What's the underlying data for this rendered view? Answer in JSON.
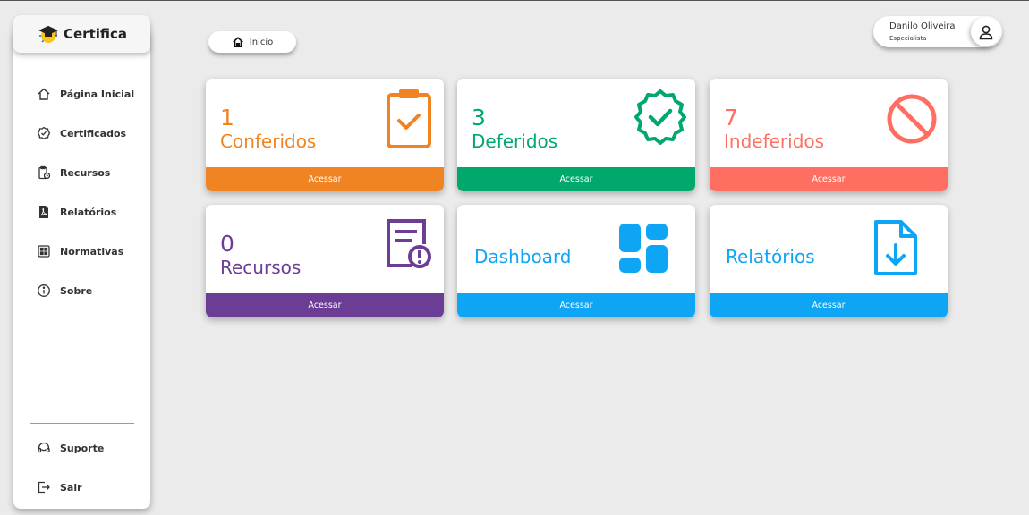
{
  "app": {
    "logo_text": "Certifica"
  },
  "sidebar": {
    "items": [
      {
        "label": "Página Inicial",
        "icon": "home-icon"
      },
      {
        "label": "Certificados",
        "icon": "badge-check-icon"
      },
      {
        "label": "Recursos",
        "icon": "clipboard-clock-icon"
      },
      {
        "label": "Relatórios",
        "icon": "pdf-file-icon"
      },
      {
        "label": "Normativas",
        "icon": "grid-icon"
      },
      {
        "label": "Sobre",
        "icon": "info-icon"
      }
    ],
    "bottom": [
      {
        "label": "Suporte",
        "icon": "headset-icon"
      },
      {
        "label": "Sair",
        "icon": "logout-icon"
      }
    ]
  },
  "breadcrumb": {
    "label": "Início"
  },
  "user": {
    "name": "Danilo Oliveira",
    "role": "Especialista"
  },
  "cards": [
    {
      "value": "1",
      "label": "Conferidos",
      "button": "Acessar",
      "color": "#f08423",
      "icon": "clipboard-check-icon"
    },
    {
      "value": "3",
      "label": "Deferidos",
      "button": "Acessar",
      "color": "#00a86b",
      "icon": "badge-check-icon"
    },
    {
      "value": "7",
      "label": "Indeferidos",
      "button": "Acessar",
      "color": "#ff6f61",
      "icon": "prohibited-icon"
    },
    {
      "value": "0",
      "label": "Recursos",
      "button": "Acessar",
      "color": "#6b3d95",
      "icon": "document-alert-icon"
    },
    {
      "value": "",
      "label": "Dashboard",
      "button": "Acessar",
      "color": "#0ea5f5",
      "icon": "dashboard-icon"
    },
    {
      "value": "",
      "label": "Relatórios",
      "button": "Acessar",
      "color": "#0ea5f5",
      "icon": "file-download-icon"
    }
  ]
}
